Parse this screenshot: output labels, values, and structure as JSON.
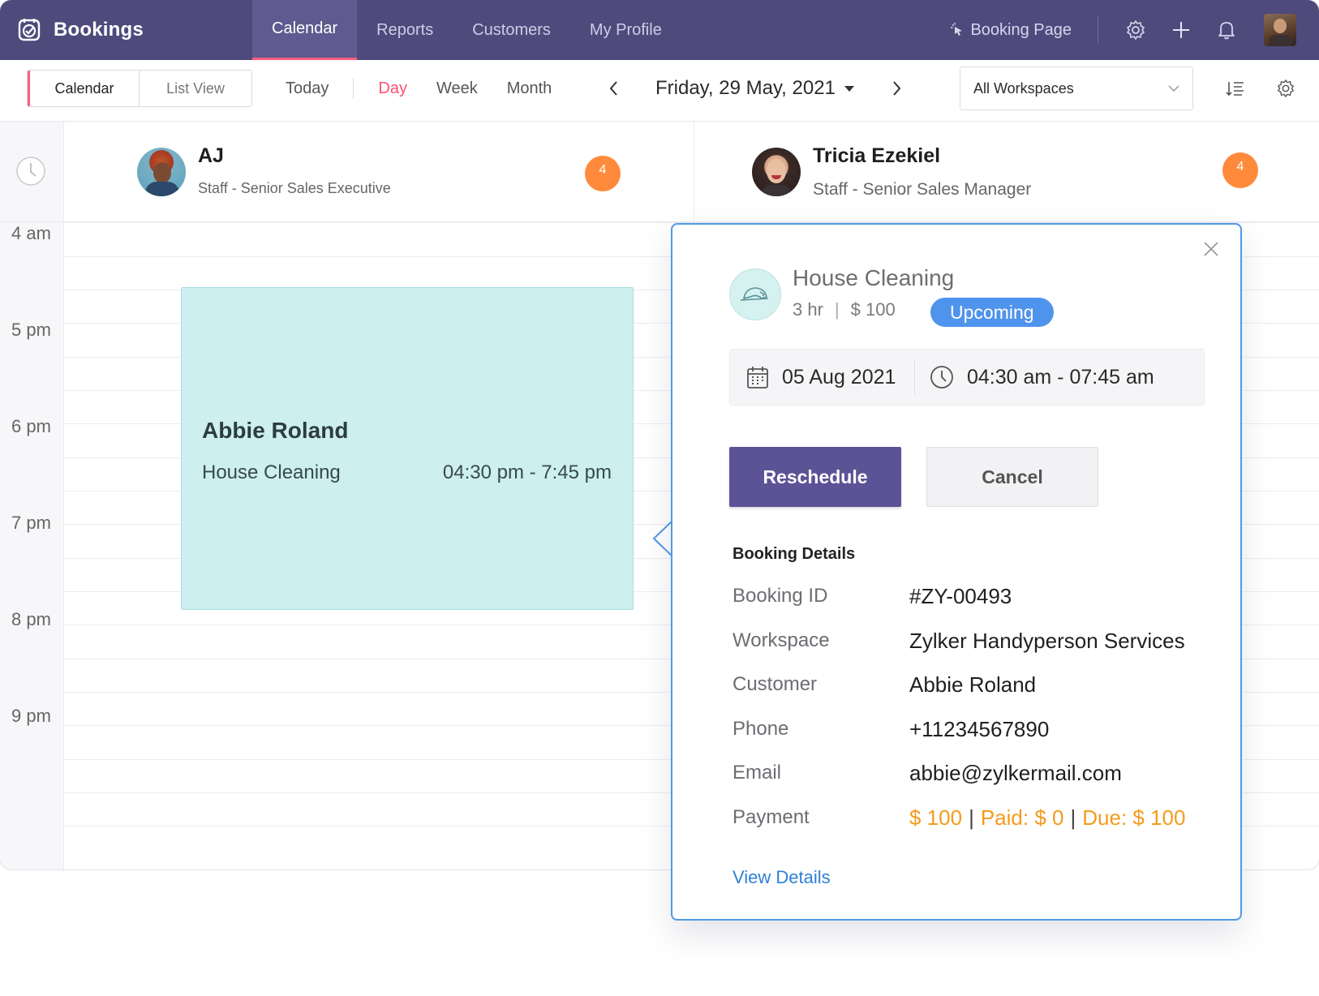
{
  "app": {
    "name": "Bookings"
  },
  "nav": {
    "tabs": [
      {
        "label": "Calendar",
        "active": true
      },
      {
        "label": "Reports",
        "active": false
      },
      {
        "label": "Customers",
        "active": false
      },
      {
        "label": "My Profile",
        "active": false
      }
    ],
    "booking_page_label": "Booking Page",
    "icons": [
      "settings-icon",
      "add-icon",
      "notification-bell-icon"
    ]
  },
  "toolbar": {
    "views": [
      {
        "label": "Calendar",
        "active": true
      },
      {
        "label": "List View",
        "active": false
      }
    ],
    "today_label": "Today",
    "periods": [
      {
        "label": "Day",
        "active": true
      },
      {
        "label": "Week",
        "active": false
      },
      {
        "label": "Month",
        "active": false
      }
    ],
    "current_date": "Friday, 29 May, 2021",
    "workspace_select": "All Workspaces"
  },
  "staff": [
    {
      "name": "AJ",
      "role": "Staff - Senior Sales Executive",
      "count": "4"
    },
    {
      "name": "Tricia Ezekiel",
      "role": "Staff - Senior Sales Manager",
      "count": "4"
    }
  ],
  "hours": [
    "4 am",
    "5 pm",
    "6 pm",
    "7 pm",
    "8 pm",
    "9 pm"
  ],
  "event": {
    "customer": "Abbie Roland",
    "service": "House Cleaning",
    "time": "04:30 pm - 7:45 pm"
  },
  "popup": {
    "service_name": "House Cleaning",
    "duration": "3 hr",
    "price": "$ 100",
    "status": "Upcoming",
    "date": "05 Aug 2021",
    "time_range": "04:30 am - 07:45 am",
    "reschedule_label": "Reschedule",
    "cancel_label": "Cancel",
    "details_title": "Booking Details",
    "details": [
      {
        "key": "Booking ID",
        "value": "#ZY-00493"
      },
      {
        "key": "Workspace",
        "value": "Zylker Handyperson Services"
      },
      {
        "key": "Customer",
        "value": "Abbie Roland"
      },
      {
        "key": "Phone",
        "value": "+11234567890"
      },
      {
        "key": "Email",
        "value": "abbie@zylkermail.com"
      }
    ],
    "payment": {
      "key": "Payment",
      "total": "$ 100",
      "paid": "Paid: $ 0",
      "due": "Due: $ 100"
    },
    "view_details_label": "View Details"
  },
  "colors": {
    "topbar": "#4f4a7c",
    "accent_pink": "#ff4f73",
    "event_bg": "#cdeff0",
    "badge_orange": "#ff8a3c",
    "status_blue": "#4f94ec",
    "reschedule": "#5c5396",
    "payment_orange": "#f59b1c",
    "link_blue": "#2f7fd8"
  }
}
